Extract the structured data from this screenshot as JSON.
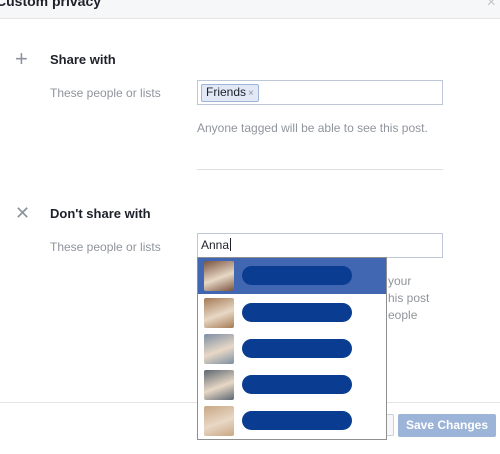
{
  "dialog": {
    "title": "Custom privacy",
    "close_icon": "×"
  },
  "share_with": {
    "icon": "+",
    "title": "Share with",
    "field_label": "These people or lists",
    "tokens": [
      {
        "label": "Friends",
        "remove_icon": "×"
      }
    ],
    "note": "Anyone tagged will be able to see this post."
  },
  "dont_share_with": {
    "icon": "✕",
    "title": "Don't share with",
    "field_label": "These people or lists",
    "input_value": "Anna",
    "partially_hidden_note": [
      "your",
      "his post",
      "eople"
    ]
  },
  "suggestions": {
    "items": [
      {
        "name": "",
        "selected": true,
        "avatar_color": "#7a5340"
      },
      {
        "name": "",
        "selected": false,
        "avatar_color": "#a57a55"
      },
      {
        "name": "",
        "selected": false,
        "avatar_color": "#7c8fa3"
      },
      {
        "name": "",
        "selected": false,
        "avatar_color": "#5c6670"
      },
      {
        "name": "",
        "selected": false,
        "avatar_color": "#c9a784"
      }
    ]
  },
  "footer": {
    "save_label": "Save Changes"
  },
  "colors": {
    "accent": "#4267b2",
    "save_disabled": "#9cb4d8",
    "redaction": "#0a3d91"
  }
}
